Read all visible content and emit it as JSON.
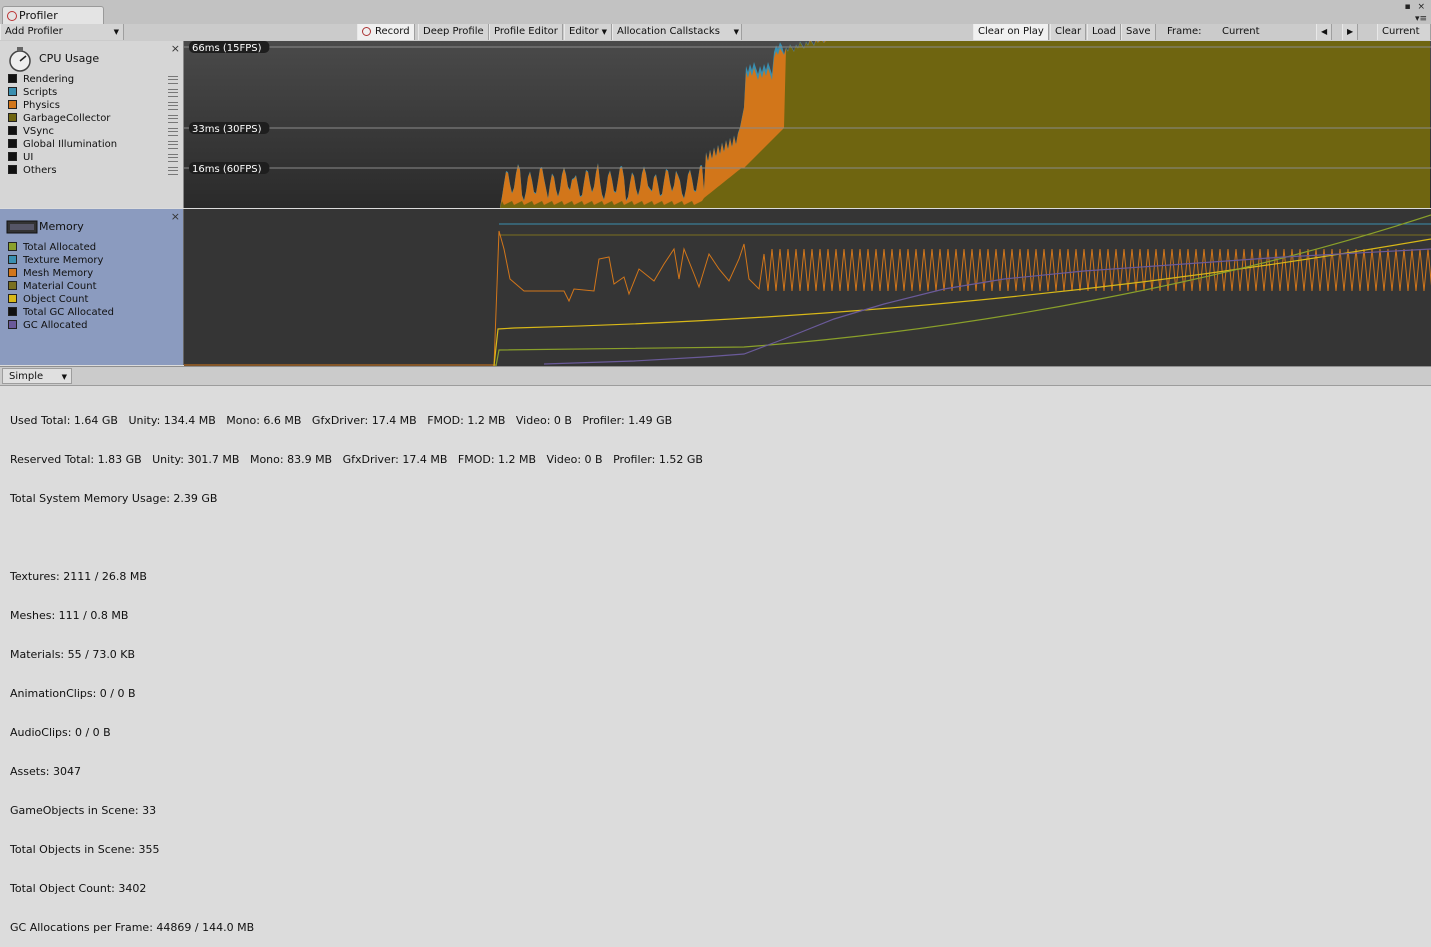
{
  "window": {
    "tab_title": "Profiler",
    "controls": "▪ ×",
    "menu": "▾≡"
  },
  "toolbar": {
    "add_profiler": "Add Profiler",
    "record": "Record",
    "deep_profile": "Deep Profile",
    "profile_editor": "Profile Editor",
    "editor": "Editor",
    "allocation_callstacks": "Allocation Callstacks",
    "clear_on_play": "Clear on Play",
    "clear": "Clear",
    "load": "Load",
    "save": "Save",
    "frame_label": "Frame:",
    "frame_value": "Current",
    "prev_frame": "◀",
    "next_frame": "▶",
    "current_button": "Current"
  },
  "cpu": {
    "title": "CPU Usage",
    "close": "×",
    "legend": [
      {
        "label": "Rendering",
        "color": "#111111"
      },
      {
        "label": "Scripts",
        "color": "#3a8fb0"
      },
      {
        "label": "Physics",
        "color": "#d2761a"
      },
      {
        "label": "GarbageCollector",
        "color": "#6f6510"
      },
      {
        "label": "VSync",
        "color": "#111111"
      },
      {
        "label": "Global Illumination",
        "color": "#111111"
      },
      {
        "label": "UI",
        "color": "#111111"
      },
      {
        "label": "Others",
        "color": "#111111"
      }
    ],
    "fps_labels": [
      "66ms (15FPS)",
      "33ms (30FPS)",
      "16ms (60FPS)"
    ]
  },
  "memory": {
    "title": "Memory",
    "close": "×",
    "legend": [
      {
        "label": "Total Allocated",
        "color": "#8aa02a"
      },
      {
        "label": "Texture Memory",
        "color": "#3a8fb0"
      },
      {
        "label": "Mesh Memory",
        "color": "#d2761a"
      },
      {
        "label": "Material Count",
        "color": "#7a7020"
      },
      {
        "label": "Object Count",
        "color": "#d8b818"
      },
      {
        "label": "Total GC Allocated",
        "color": "#111111"
      },
      {
        "label": "GC Allocated",
        "color": "#6a5a9a"
      }
    ]
  },
  "bottom": {
    "mode": "Simple"
  },
  "stats": {
    "used_total": "Used Total: 1.64 GB   Unity: 134.4 MB   Mono: 6.6 MB   GfxDriver: 17.4 MB   FMOD: 1.2 MB   Video: 0 B   Profiler: 1.49 GB",
    "reserved_total": "Reserved Total: 1.83 GB   Unity: 301.7 MB   Mono: 83.9 MB   GfxDriver: 17.4 MB   FMOD: 1.2 MB   Video: 0 B   Profiler: 1.52 GB",
    "system_usage": "Total System Memory Usage: 2.39 GB",
    "textures": "Textures: 2111 / 26.8 MB",
    "meshes": "Meshes: 111 / 0.8 MB",
    "materials": "Materials: 55 / 73.0 KB",
    "animation_clips": "AnimationClips: 0 / 0 B",
    "audio_clips": "AudioClips: 0 / 0 B",
    "assets": "Assets: 3047",
    "gameobjects": "GameObjects in Scene: 33",
    "total_objects": "Total Objects in Scene: 355",
    "total_object_count": "Total Object Count: 3402",
    "gc_allocations": "GC Allocations per Frame: 44869 / 144.0 MB"
  }
}
